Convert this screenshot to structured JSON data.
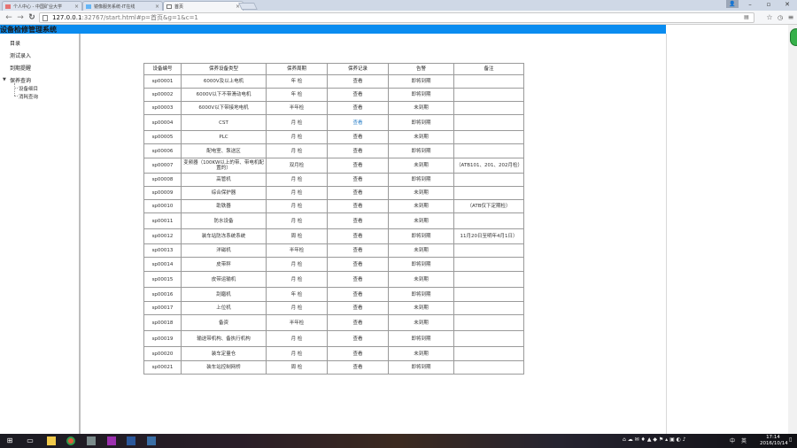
{
  "browser": {
    "tabs": [
      {
        "label": "个人中心 - 中国矿业大学"
      },
      {
        "label": "镜像服务系统-IT在线"
      },
      {
        "label": "首页"
      }
    ],
    "window_controls": {
      "minimize": "–",
      "maximize": "▫",
      "close": "✕",
      "user": "👤"
    },
    "address": {
      "host": "127.0.0.1",
      "rest": ":32767/start.html#p=首页&g=1&c=1"
    }
  },
  "app": {
    "title": "设备检修管理系统",
    "header_color": "#0a8cf0"
  },
  "sidebar": {
    "items": [
      {
        "label": "目录"
      },
      {
        "label": "测试录入"
      },
      {
        "label": "到期提醒"
      },
      {
        "label": "保养查询"
      }
    ],
    "subitems": [
      {
        "label": "设备细目"
      },
      {
        "label": "消耗查询"
      }
    ]
  },
  "table": {
    "headers": [
      "设备编号",
      "保养设备类型",
      "保养周期",
      "保养记录",
      "告警",
      "备注"
    ],
    "rows": [
      {
        "id": "sp00001",
        "type": "6000V及以上电机",
        "period": "年 检",
        "record": "查看",
        "alarm": "即将到期",
        "note": ""
      },
      {
        "id": "sp00002",
        "type": "6000V以下不带滑动电机",
        "period": "年 检",
        "record": "查看",
        "alarm": "即将到期",
        "note": ""
      },
      {
        "id": "sp00003",
        "type": "6000V以下带接地电机",
        "period": "半年检",
        "record": "查看",
        "alarm": "未到期",
        "note": ""
      },
      {
        "id": "sp00004",
        "type": "CST",
        "period": "月 检",
        "record": "查看",
        "alarm": "即将到期",
        "note": ""
      },
      {
        "id": "sp00005",
        "type": "PLC",
        "period": "月 检",
        "record": "查看",
        "alarm": "未到期",
        "note": ""
      },
      {
        "id": "sp00006",
        "type": "配电室、泵送区",
        "period": "月 检",
        "record": "查看",
        "alarm": "即将到期",
        "note": ""
      },
      {
        "id": "sp00007",
        "type": "变频器（100KW以上的带、带电机配置的）",
        "period": "双月检",
        "record": "查看",
        "alarm": "未到期",
        "note": "（ATB101、201、202月检）"
      },
      {
        "id": "sp00008",
        "type": "高管机",
        "period": "月 检",
        "record": "查看",
        "alarm": "即将到期",
        "note": ""
      },
      {
        "id": "sp00009",
        "type": "综合保护器",
        "period": "月 检",
        "record": "查看",
        "alarm": "未到期",
        "note": ""
      },
      {
        "id": "sp00010",
        "type": "助铁器",
        "period": "月 检",
        "record": "查看",
        "alarm": "未到期",
        "note": "（ATB仅下定期检）"
      },
      {
        "id": "sp00011",
        "type": "防水设备",
        "period": "月 检",
        "record": "查看",
        "alarm": "未到期",
        "note": ""
      },
      {
        "id": "sp00012",
        "type": "装车站防冻系统系统",
        "period": "周 检",
        "record": "查看",
        "alarm": "即将到期",
        "note": "11月20日至明年4月1日）"
      },
      {
        "id": "sp00013",
        "type": "洋磁机",
        "period": "半年检",
        "record": "查看",
        "alarm": "未到期",
        "note": ""
      },
      {
        "id": "sp00014",
        "type": "皮带秤",
        "period": "月 检",
        "record": "查看",
        "alarm": "即将到期",
        "note": ""
      },
      {
        "id": "sp00015",
        "type": "皮带运输机",
        "period": "月 检",
        "record": "查看",
        "alarm": "未到期",
        "note": ""
      },
      {
        "id": "sp00016",
        "type": "刮磨机",
        "period": "年 检",
        "record": "查看",
        "alarm": "即将到期",
        "note": ""
      },
      {
        "id": "sp00017",
        "type": "上位机",
        "period": "月 检",
        "record": "查看",
        "alarm": "未到期",
        "note": ""
      },
      {
        "id": "sp00018",
        "type": "备资",
        "period": "半年检",
        "record": "查看",
        "alarm": "未到期",
        "note": ""
      },
      {
        "id": "sp00019",
        "type": "输送带机构、备执行机构",
        "period": "月 检",
        "record": "查看",
        "alarm": "即将到期",
        "note": ""
      },
      {
        "id": "sp00020",
        "type": "装车定量仓",
        "period": "月 检",
        "record": "查看",
        "alarm": "未到期",
        "note": ""
      },
      {
        "id": "sp00021",
        "type": "装车站控制网桥",
        "period": "周 检",
        "record": "查看",
        "alarm": "即将到期",
        "note": ""
      }
    ]
  },
  "taskbar": {
    "tray_lang": "英",
    "tray_ime": "中",
    "time": "17:14",
    "date": "2016/10/14"
  }
}
